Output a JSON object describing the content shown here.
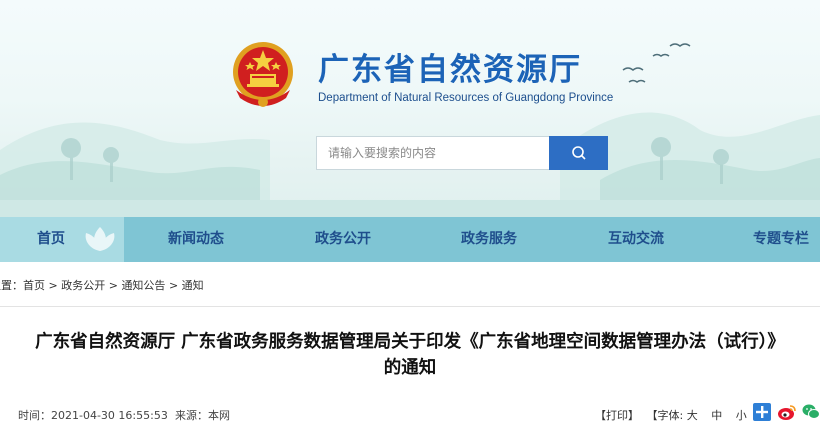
{
  "site": {
    "title": "广东省自然资源厅",
    "subtitle": "Department of Natural Resources of Guangdong Province"
  },
  "search": {
    "placeholder": "请输入要搜索的内容",
    "icon": "search-icon"
  },
  "nav": {
    "items": [
      {
        "label": "首页",
        "active": true
      },
      {
        "label": "新闻动态"
      },
      {
        "label": "政务公开"
      },
      {
        "label": "政务服务"
      },
      {
        "label": "互动交流"
      },
      {
        "label": "专题专栏"
      }
    ]
  },
  "breadcrumb": {
    "prefix": "位置：",
    "items": [
      "首页",
      "政务公开",
      "通知公告",
      "通知"
    ],
    "separator": ">"
  },
  "article": {
    "title_line1": "广东省自然资源厅 广东省政务服务数据管理局关于印发《广东省地理空间数据管理办法（试行）》",
    "title_line2": "的通知",
    "time_label": "时间：",
    "time": "2021-04-30 16:55:53",
    "source_label": "来源：",
    "source": "本网"
  },
  "tools": {
    "print": "【打印】",
    "font_label": "【字体:",
    "font_large": "大",
    "font_medium": "中",
    "font_small": "小",
    "font_close": "】"
  },
  "share": [
    "plus-share-icon",
    "weibo-icon",
    "wechat-icon"
  ],
  "colors": {
    "brand_blue": "#1c63b7",
    "nav_bg": "#7fc5d4",
    "nav_active": "#a9dbe3",
    "search_button": "#2d6ec4"
  }
}
